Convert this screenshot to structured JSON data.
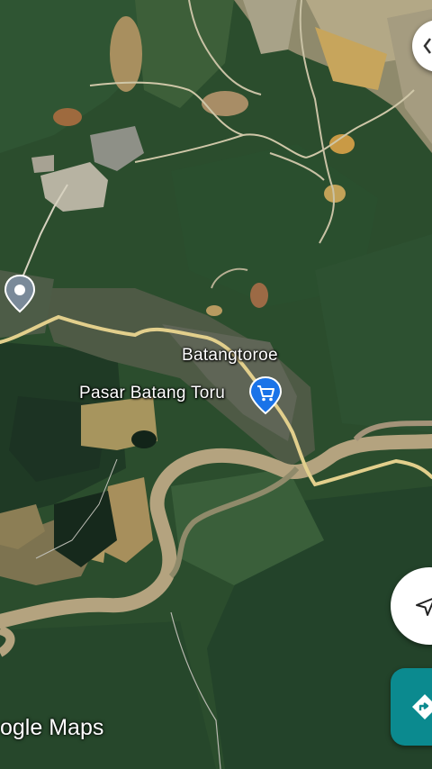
{
  "map": {
    "place_labels": {
      "town": "Batangtoroe",
      "market": "Pasar Batang Toru"
    },
    "icons": {
      "location_pin": "location-pin-icon",
      "shopping_pin": "shopping-cart-icon",
      "navigate": "navigation-arrow-icon",
      "directions": "directions-icon",
      "partial_top_button": "map-control-icon"
    },
    "watermark": {
      "text": "ogle Maps"
    },
    "colors": {
      "road": "#e2cf8c",
      "river": "#b3a07a",
      "forest": "#284a2b",
      "pin_blue": "#1a73e8",
      "directions_teal": "#0b8a8f"
    }
  }
}
